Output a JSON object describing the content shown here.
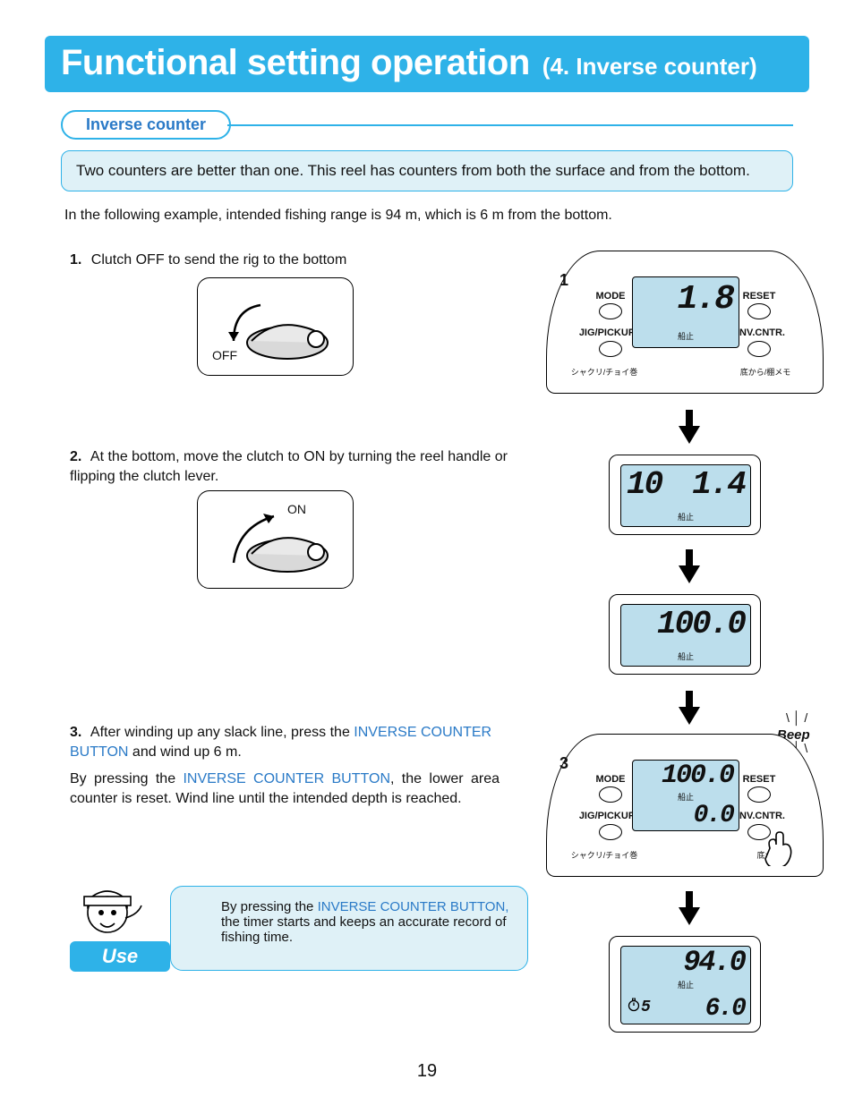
{
  "title": {
    "main": "Functional setting operation",
    "sub": "(4. Inverse counter)"
  },
  "section_label": "Inverse counter",
  "intro_box": "Two counters are better than one. This reel has counters from both the surface and from the bottom.",
  "intro_note": "In the following example, intended fishing range is 94 m, which is 6 m from the bottom.",
  "steps": {
    "s1": {
      "n": "1.",
      "text": "Clutch OFF to send the rig to the bottom"
    },
    "s2": {
      "n": "2.",
      "text": "At the bottom, move the clutch to ON by turning the reel handle or flipping the clutch lever."
    },
    "s3": {
      "n": "3.",
      "pre": "After winding up any slack line, press the ",
      "link": "INVERSE COUNTER BUTTON",
      "post": " and wind up 6 m."
    },
    "s3b": {
      "pre": "By pressing the ",
      "link": "INVERSE COUNTER BUTTON",
      "post": ", the lower area counter is reset. Wind line until the intended depth is reached."
    }
  },
  "clutch": {
    "off": "OFF",
    "on": "ON"
  },
  "panel_labels": {
    "mode": "MODE",
    "reset": "RESET",
    "jig": "JIG/PICKUP",
    "inv": "INV.CNTR.",
    "jp_left": "シャクリ/チョイ巻",
    "jp_right_full": "底から/棚メモ",
    "jp_right_short": "底から",
    "jp_small": "船止"
  },
  "displays": {
    "p1": {
      "num": "1",
      "big": "1.8"
    },
    "d2": {
      "left": "10",
      "right": "1.4"
    },
    "d3": {
      "big": "100.0"
    },
    "p3": {
      "num": "3",
      "big": "100.0",
      "small": "0.0",
      "beep": "Beep !"
    },
    "d5": {
      "big": "94.0",
      "small": "6.0",
      "timer": "5"
    }
  },
  "tip": {
    "pre": "By pressing the ",
    "link": "INVERSE COUNTER BUTTON,",
    "post": " the timer starts and keeps an accurate record of fishing time.",
    "tab": "Use"
  },
  "page_number": "19"
}
